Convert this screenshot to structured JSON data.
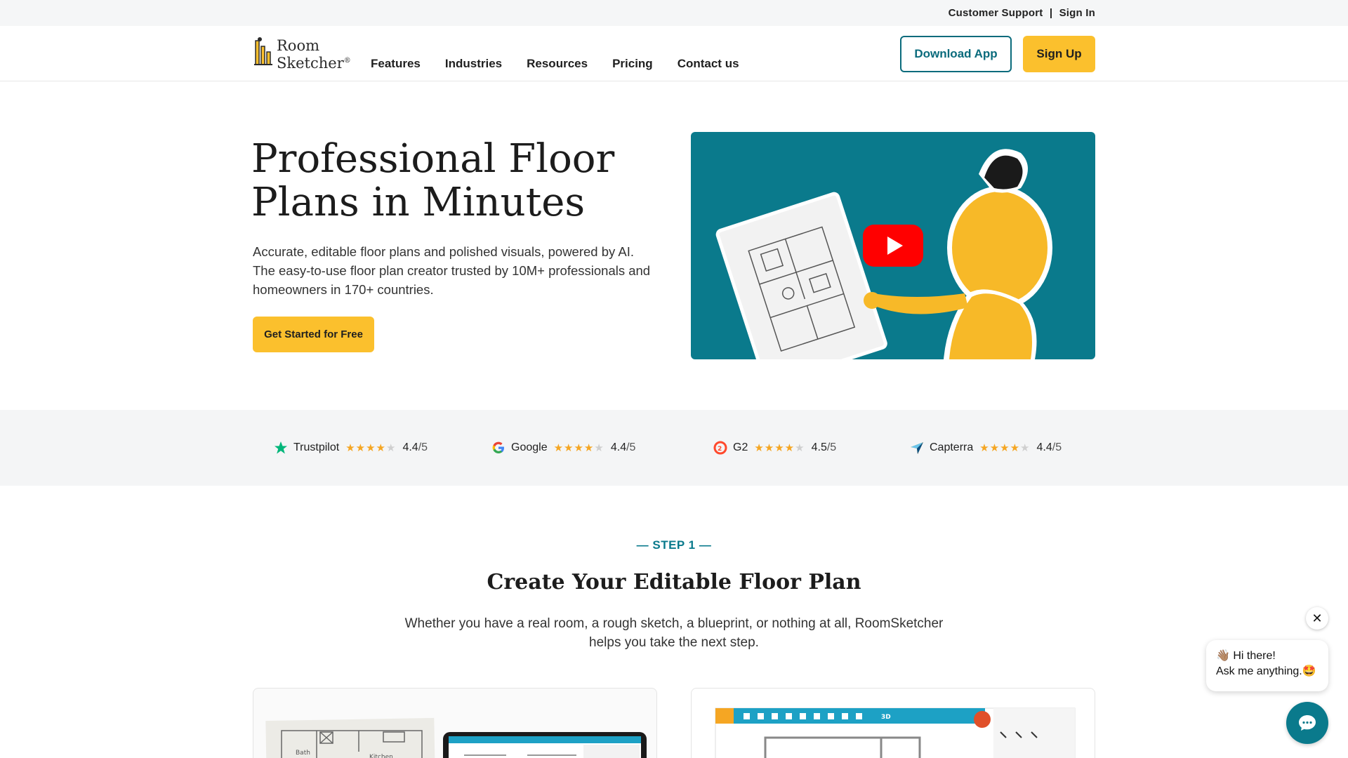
{
  "utility": {
    "support": "Customer Support",
    "separator": "|",
    "signin": "Sign In"
  },
  "logo": {
    "line1": "Room",
    "line2": "Sketcher",
    "mark": "®"
  },
  "nav": {
    "items": [
      "Features",
      "Industries",
      "Resources",
      "Pricing",
      "Contact us"
    ]
  },
  "header_buttons": {
    "download": "Download App",
    "signup": "Sign Up"
  },
  "hero": {
    "title": "Professional Floor Plans in Minutes",
    "description": "Accurate, editable floor plans and polished visuals, powered by AI. The easy-to-use floor plan creator trusted by 10M+ professionals and homeowners in 170+ countries.",
    "cta": "Get Started for Free"
  },
  "video": {
    "play_icon": "youtube-play-icon"
  },
  "ratings": [
    {
      "name": "Trustpilot",
      "score": "4.4",
      "out_of": "/5",
      "stars": 4.4,
      "icon": "trustpilot-star-icon"
    },
    {
      "name": "Google",
      "score": "4.4",
      "out_of": "/5",
      "stars": 4.4,
      "icon": "google-g-icon"
    },
    {
      "name": "G2",
      "score": "4.5",
      "out_of": "/5",
      "stars": 4.5,
      "icon": "g2-icon"
    },
    {
      "name": "Capterra",
      "score": "4.4",
      "out_of": "/5",
      "stars": 4.4,
      "icon": "capterra-icon"
    }
  ],
  "step": {
    "label": "— STEP 1 —",
    "title": "Create Your Editable Floor Plan",
    "description": "Whether you have a real room, a rough sketch, a blueprint, or nothing at all, RoomSketcher helps you take the next step."
  },
  "chat": {
    "greeting": "👋🏽 Hi there!",
    "prompt": "Ask me anything.🤩",
    "close": "✕"
  },
  "colors": {
    "accent": "#0a7a8c",
    "cta": "#fbc02d",
    "star": "#f5a623"
  }
}
